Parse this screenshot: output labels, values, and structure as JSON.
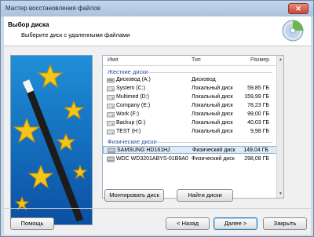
{
  "window": {
    "title": "Мастер восстановления файлов",
    "close_label": "✕"
  },
  "header": {
    "title": "Выбор диска",
    "subtitle": "Выберите диск с удаленными файлами"
  },
  "columns": {
    "name": "Имя",
    "type": "Тип",
    "size": "Размер"
  },
  "groups": {
    "hard_disks": "Жесткие диски",
    "physical_disks": "Физические диски"
  },
  "rows": [
    {
      "name": "Дисковод (A:)",
      "type": "Дисковод",
      "size": ""
    },
    {
      "name": "System (C:)",
      "type": "Локальный диск",
      "size": "59,85 ГБ"
    },
    {
      "name": "Multimed (D:)",
      "type": "Локальный диск",
      "size": "159,99 ГБ"
    },
    {
      "name": "Company (E:)",
      "type": "Локальный диск",
      "size": "78,23 ГБ"
    },
    {
      "name": "Work (F:)",
      "type": "Локальный диск",
      "size": "99,00 ГБ"
    },
    {
      "name": "Backup (G:)",
      "type": "Локальный диск",
      "size": "40,03 ГБ"
    },
    {
      "name": "TEST (H:)",
      "type": "Локальный диск",
      "size": "9,98 ГБ"
    },
    {
      "name": "SAMSUNG HD161HJ",
      "type": "Физический диск",
      "size": "149,04 ГБ"
    },
    {
      "name": "WDC WD3201ABYS-01B9A0",
      "type": "Физический диск",
      "size": "298,08 ГБ"
    }
  ],
  "buttons": {
    "mount": "Монтировать диск",
    "find": "Найти диски",
    "help": "Помощь",
    "back": "< Назад",
    "next": "Далее >",
    "close": "Закрыть"
  },
  "colors": {
    "accent": "#2a4f9e",
    "selection": "#dfeaf8"
  }
}
